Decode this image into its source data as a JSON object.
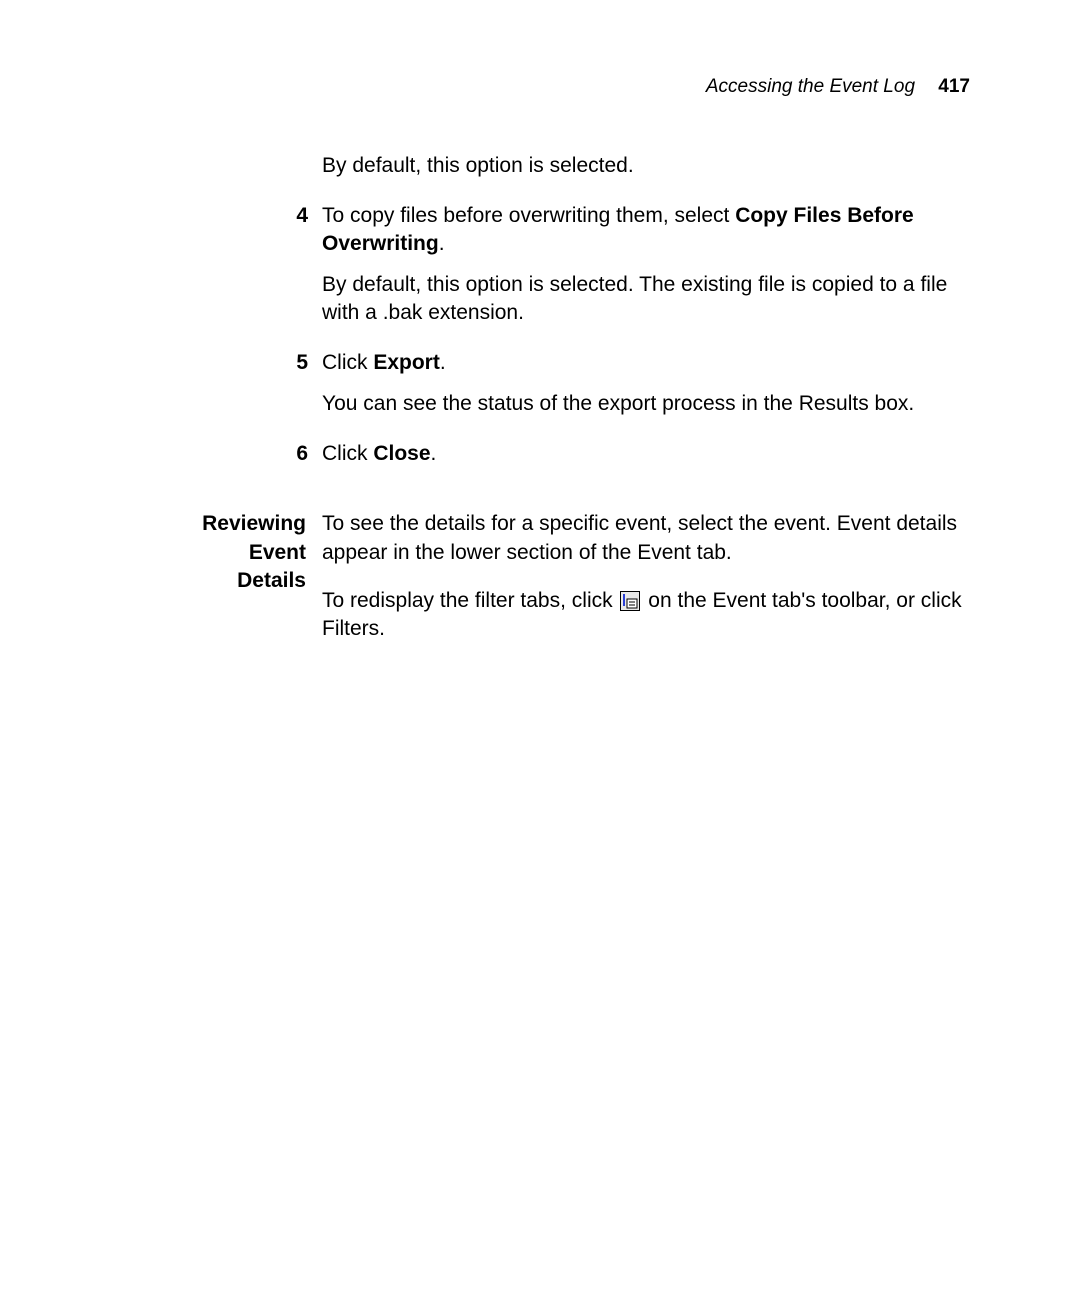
{
  "header": {
    "running_title": "Accessing the Event Log",
    "page_number": "417"
  },
  "intro": {
    "default_selected": "By default, this option is selected."
  },
  "step4": {
    "num": "4",
    "lead": "To copy files before overwriting them, select ",
    "bold": "Copy Files Before Overwriting",
    "tail": ".",
    "detail": "By default, this option is selected. The existing file is copied to a file with a .bak extension."
  },
  "step5": {
    "num": "5",
    "lead": "Click ",
    "bold": "Export",
    "tail": ".",
    "detail": "You can see the status of the export process in the Results box."
  },
  "step6": {
    "num": "6",
    "lead": "Click ",
    "bold": "Close",
    "tail": "."
  },
  "section": {
    "heading_line1": "Reviewing Event",
    "heading_line2": "Details",
    "p1": "To see the details for a specific event, select the event. Event details appear in the lower section of the Event tab.",
    "p2_lead": "To redisplay the filter tabs, click ",
    "p2_tail": " on the Event tab's toolbar, or click Filters."
  }
}
